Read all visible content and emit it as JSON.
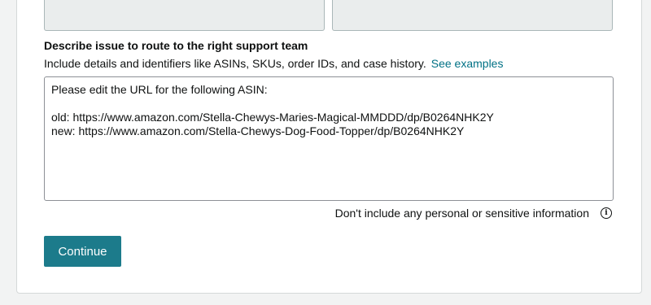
{
  "form": {
    "heading": "Describe issue to route to the right support team",
    "helper_text": "Include details and identifiers like ASINs, SKUs, order IDs, and case history.",
    "examples_link": "See examples",
    "description_value": "Please edit the URL for the following ASIN:\n\nold: https://www.amazon.com/Stella-Chewys-Maries-Magical-MMDDD/dp/B0264NHK2Y\nnew: https://www.amazon.com/Stella-Chewys-Dog-Food-Topper/dp/B0264NHK2Y",
    "privacy_note": "Don't include any personal or sensitive information",
    "info_icon": "info-icon",
    "continue_label": "Continue"
  },
  "colors": {
    "accent": "#1c7b8b",
    "link": "#007185"
  }
}
